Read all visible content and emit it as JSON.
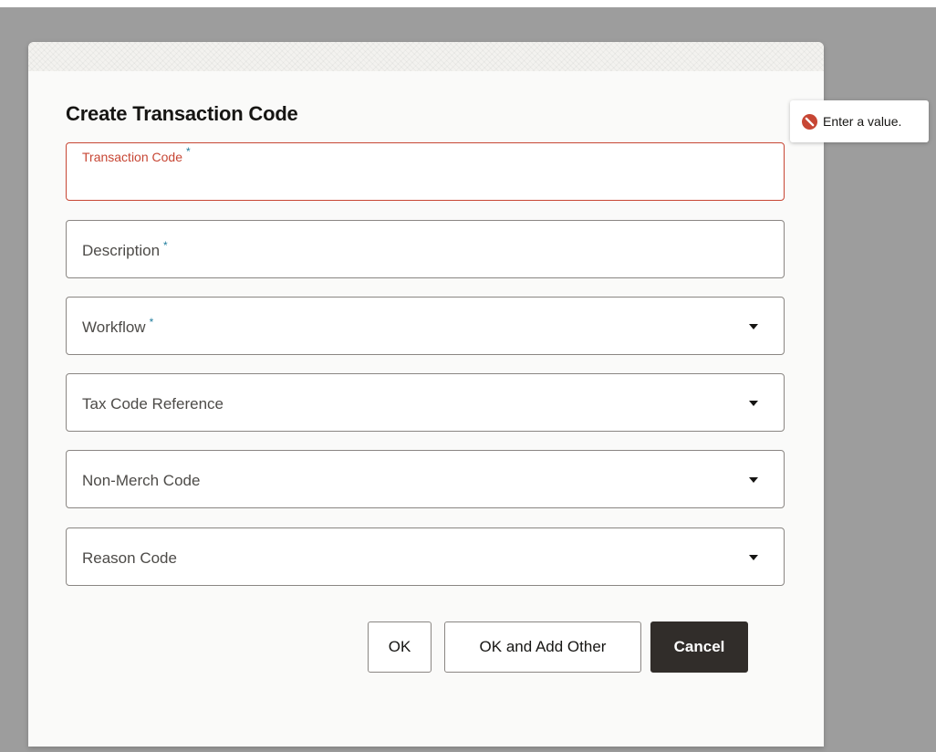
{
  "dialog": {
    "title": "Create Transaction Code",
    "fields": [
      {
        "label": "Transaction Code",
        "required_marker": "*",
        "state": "error",
        "type": "text"
      },
      {
        "label": "Description",
        "required_marker": "*",
        "type": "text"
      },
      {
        "label": "Workflow",
        "required_marker": "*",
        "type": "select"
      },
      {
        "label": "Tax Code Reference",
        "type": "select"
      },
      {
        "label": "Non-Merch Code",
        "type": "select"
      },
      {
        "label": "Reason Code",
        "type": "select"
      }
    ],
    "buttons": {
      "ok_label": "OK",
      "ok_add_other_label": "OK and Add Other",
      "cancel_label": "Cancel"
    }
  },
  "validation_tooltip": {
    "message": "Enter a value.",
    "icon": "error-circle-icon"
  },
  "colors": {
    "error": "#c74634",
    "required_marker": "#227e9e",
    "primary_button": "#312d2a",
    "overlay": "#9d9d9d"
  }
}
